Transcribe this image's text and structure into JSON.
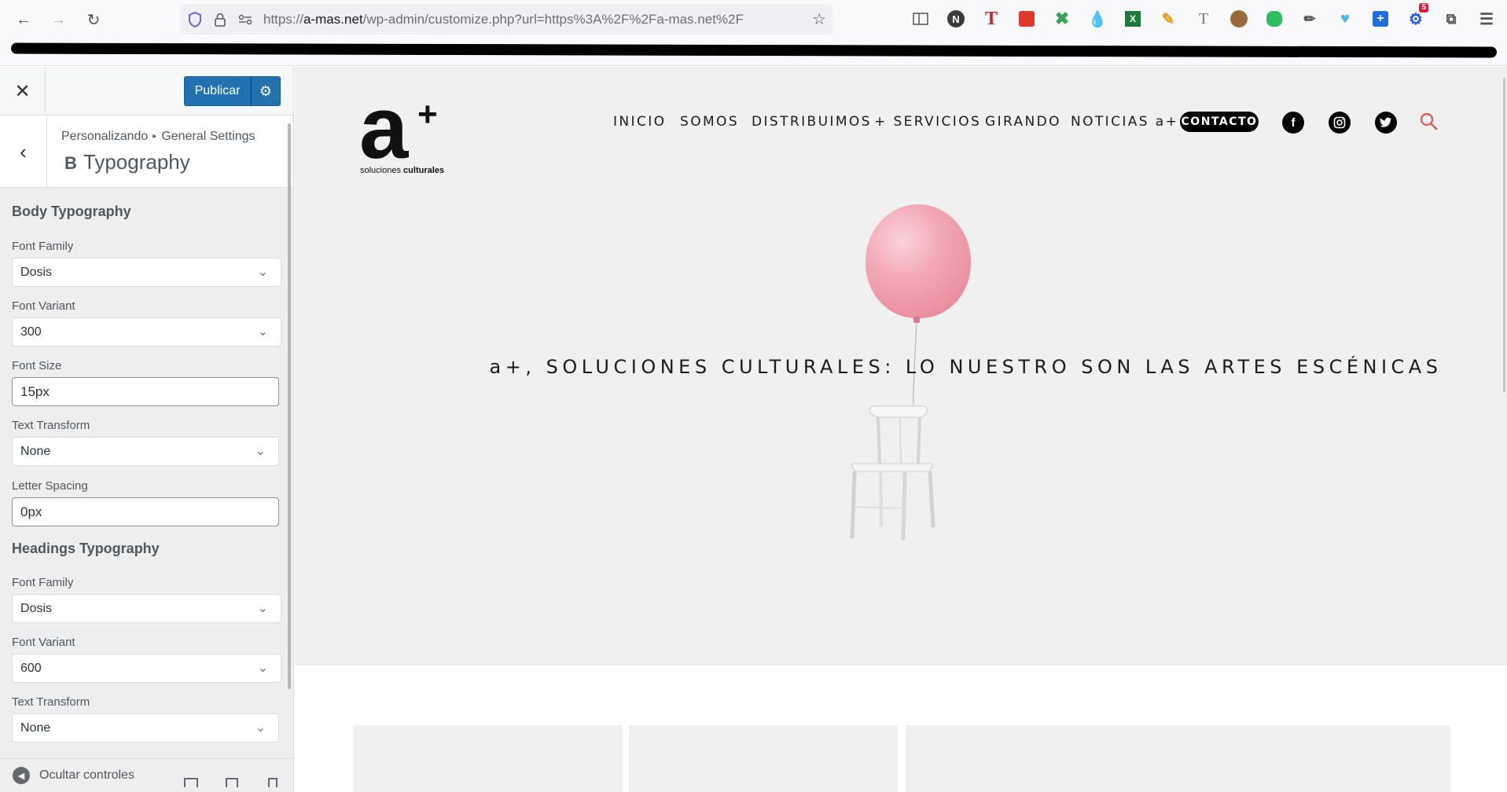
{
  "browser": {
    "url_host_prefix": "https://",
    "url_host": "a-mas.net",
    "url_path": "/wp-admin/customize.php?url=https%3A%2F%2Fa-mas.net%2F",
    "extensions": [
      "reader-view-icon",
      "n-icon",
      "t-icon",
      "stack-icon",
      "scissors-icon",
      "drop-icon",
      "excel-icon",
      "pen-icon",
      "text-icon",
      "monkey-icon",
      "evernote-icon",
      "eyedropper-icon",
      "heart-icon",
      "plus-icon",
      "gear-icon",
      "puzzle-icon",
      "menu-icon"
    ],
    "extension_badge": "5"
  },
  "customizer": {
    "publish_label": "Publicar",
    "breadcrumb_root": "Personalizando",
    "breadcrumb_section": "General Settings",
    "section_title": "Typography",
    "section_title_mark": "B",
    "body_title": "Body Typography",
    "body": {
      "font_family_label": "Font Family",
      "font_family_value": "Dosis",
      "font_variant_label": "Font Variant",
      "font_variant_value": "300",
      "font_size_label": "Font Size",
      "font_size_value": "15px",
      "text_transform_label": "Text Transform",
      "text_transform_value": "None",
      "letter_spacing_label": "Letter Spacing",
      "letter_spacing_value": "0px"
    },
    "headings_title": "Headings Typography",
    "headings": {
      "font_family_label": "Font Family",
      "font_family_value": "Dosis",
      "font_variant_label": "Font Variant",
      "font_variant_value": "600",
      "text_transform_label": "Text Transform",
      "text_transform_value": "None"
    },
    "hide_controls_label": "Ocultar controles"
  },
  "site": {
    "logo_letter": "a",
    "logo_plus": "+",
    "logo_sub_plain": "soluciones ",
    "logo_sub_bold": "culturales",
    "menu": [
      "INICIO",
      "SOMOS",
      "DISTRIBUIMOS",
      "+ SERVICIOS",
      "GIRANDO",
      "NOTICIAS a+"
    ],
    "contact": "CONTACTO",
    "social": [
      "facebook-icon",
      "instagram-icon",
      "twitter-icon"
    ],
    "headline": "a+, SOLUCIONES CULTURALES: LO NUESTRO SON LAS ARTES ESCÉNICAS",
    "accent_search": "#e35b5b",
    "balloon_color": "#f3a8b4",
    "publish_color": "#2271b1"
  }
}
